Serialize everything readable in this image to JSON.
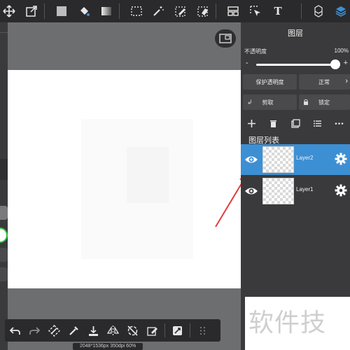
{
  "toolbar": {
    "tools": [
      "move-tool",
      "transform-tool",
      "fill-color",
      "bucket-tool",
      "gradient-tool",
      "select-rect-tool",
      "magic-wand-tool",
      "select-pen-tool",
      "select-eraser-tool",
      "frame-tool",
      "select-move-tool",
      "text-tool",
      "material-tool",
      "layers-tool"
    ],
    "text_tool_label": "T"
  },
  "canvas": {
    "status": "2048*1536px 350dpi 60%"
  },
  "bottom_toolbar": {
    "tools": [
      "undo",
      "redo",
      "transform",
      "eyedropper",
      "save",
      "flip",
      "rotate",
      "edit",
      "snap",
      "menu"
    ]
  },
  "panel": {
    "title": "图层",
    "opacity_label": "不透明度",
    "opacity_value": "100%",
    "opacity_level": 1.0,
    "minus": "-",
    "plus": "+",
    "protect_alpha": "保护透明度",
    "blend_mode": "正常",
    "clip": "剪取",
    "lock": "锁定",
    "list_title": "图层列表",
    "layers": [
      {
        "name": "Layer2",
        "selected": true
      },
      {
        "name": "Layer1",
        "selected": false
      }
    ]
  },
  "watermark": "软件技巧",
  "colors": {
    "toolbar_bg": "#2a2a2c",
    "panel_bg": "#3a3a3c",
    "workspace_bg": "#6d6e70",
    "selected_layer": "#3d8fd4",
    "arrow": "#e53a3a"
  }
}
